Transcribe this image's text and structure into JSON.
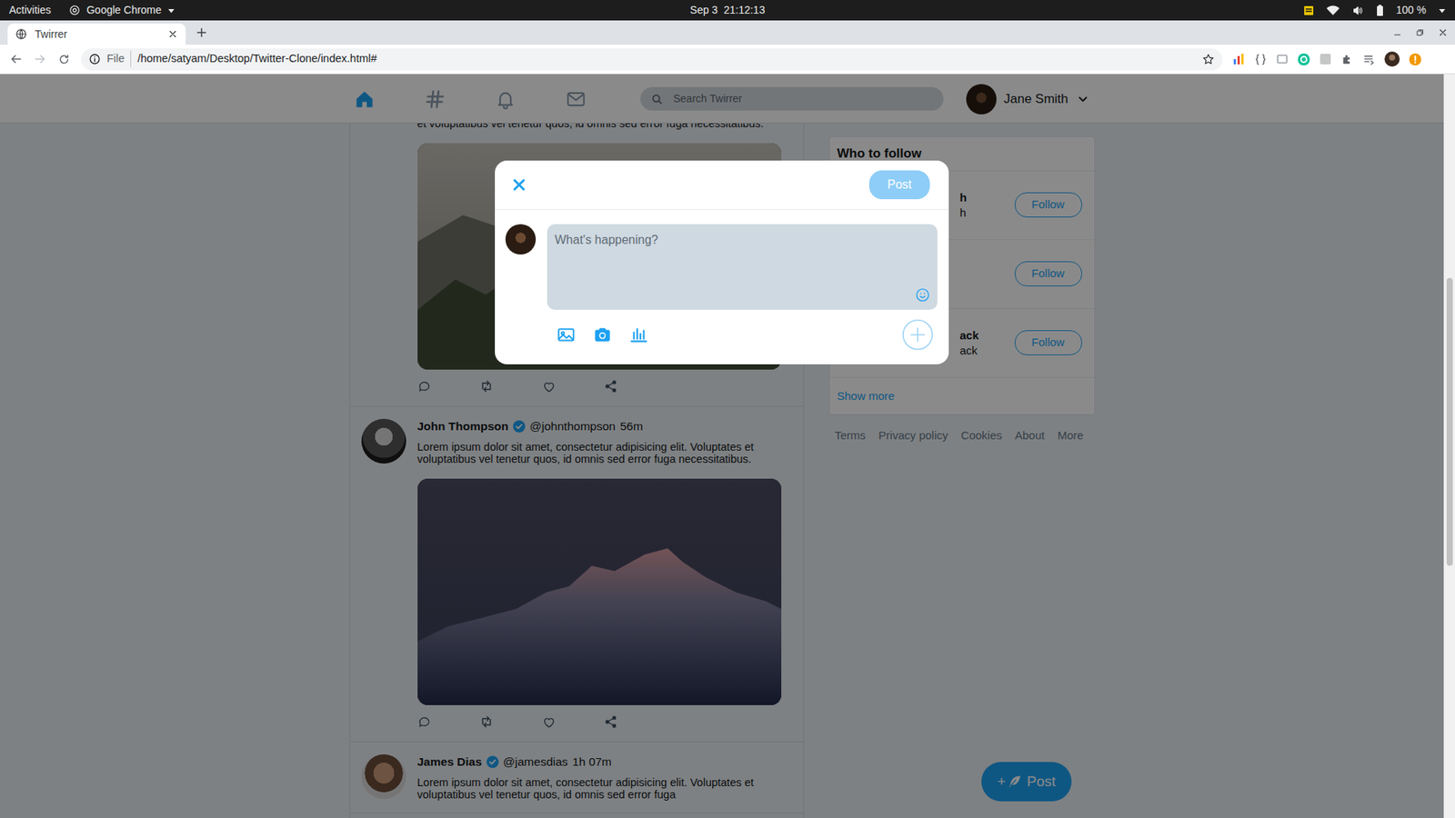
{
  "system_bar": {
    "activities": "Activities",
    "app": "Google Chrome",
    "clock": "Sep 3  21:12:13",
    "battery": "100 %"
  },
  "browser": {
    "tabs": [
      {
        "label": "Twirrer",
        "selected": true
      }
    ],
    "address": {
      "scheme": "File",
      "url": "/home/satyam/Desktop/Twitter-Clone/index.html#"
    }
  },
  "nav": {
    "items": [
      {
        "kind": "home",
        "selected": true
      },
      {
        "kind": "explore",
        "selected": false
      },
      {
        "kind": "notifications",
        "selected": false
      },
      {
        "kind": "messages",
        "selected": false
      }
    ],
    "search": {
      "placeholder": "Search Twirrer"
    },
    "user": {
      "name": "Jane Smith"
    }
  },
  "feed": {
    "tweets": [
      {
        "kind": "photo",
        "text": "et voluptatibus vel tenetur quos, id omnis sed error fuga necessitatibus."
      },
      {
        "kind": "photo",
        "name": "John Thompson",
        "verified": true,
        "handle": "@johnthompson",
        "time": "56m",
        "text": "Lorem ipsum dolor sit amet, consectetur adipisicing elit. Voluptates et voluptatibus vel tenetur quos, id omnis sed error fuga necessitatibus."
      },
      {
        "kind": "text",
        "name": "James Dias",
        "verified": true,
        "handle": "@jamesdias",
        "time": "1h 07m",
        "text": "Lorem ipsum dolor sit amet, consectetur adipisicing elit. Voluptates et voluptatibus vel tenetur quos, id omnis sed error fuga"
      }
    ]
  },
  "who_to_follow": {
    "title": "Who to follow",
    "people": [
      {
        "name": "h",
        "handle": "h",
        "button": "Follow"
      },
      {
        "button": "Follow"
      },
      {
        "name": "ack",
        "handle": "ack",
        "button": "Follow"
      }
    ],
    "more": "Show more"
  },
  "footer": {
    "links": [
      "Terms",
      "Privacy policy",
      "Cookies",
      "About",
      "More"
    ]
  },
  "compose": {
    "placeholder": "What's happening?",
    "post_button": {
      "label": "Post",
      "disabled": true
    }
  },
  "fab": {
    "icon": "+",
    "label": "Post"
  }
}
